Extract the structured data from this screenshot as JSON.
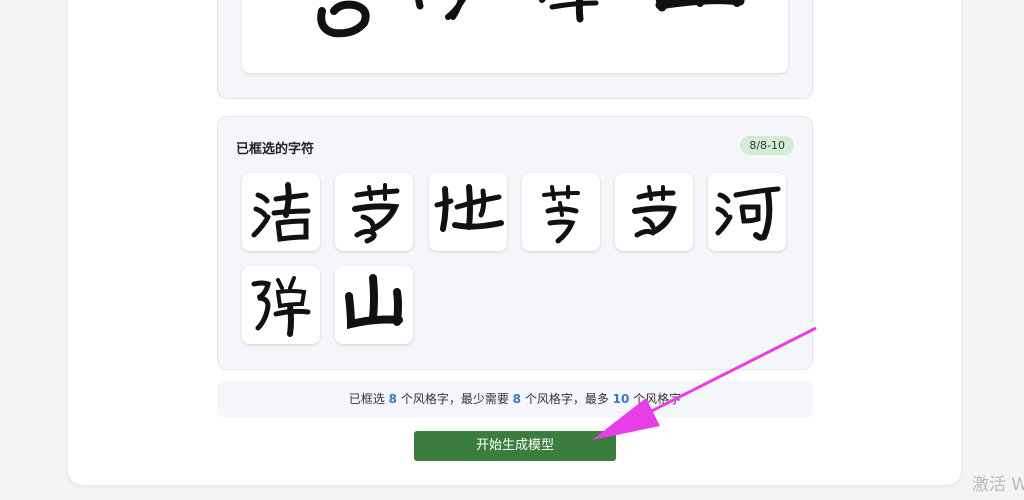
{
  "selected": {
    "title": "已框选的字符",
    "badge": "8/8-10",
    "glyphs": [
      "浩",
      "荡",
      "地",
      "芳",
      "荡",
      "河",
      "弹",
      "山"
    ]
  },
  "info": {
    "prefix": "已框选 ",
    "count": "8",
    "mid1": " 个风格字，最少需要 ",
    "min": "8",
    "mid2": " 个风格字，最多 ",
    "max": "10",
    "suffix": " 个风格字"
  },
  "start_button": "开始生成模型",
  "watermark": "激活 W",
  "colors": {
    "button": "#3a7d3c",
    "badge_bg": "#d4ecd6",
    "number": "#3a78c2",
    "arrow": "#e83ee8"
  }
}
